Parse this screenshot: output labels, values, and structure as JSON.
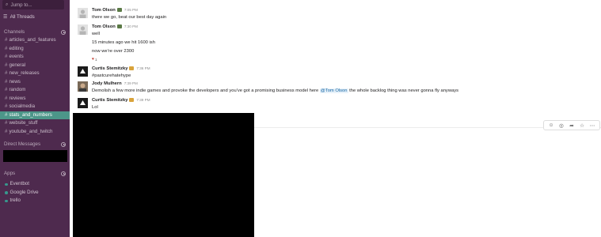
{
  "sidebar": {
    "jump_placeholder": "Jump to...",
    "all_threads": "All Threads",
    "channels_header": "Channels",
    "channels": [
      {
        "label": "articles_and_features",
        "active": false
      },
      {
        "label": "editing",
        "active": false
      },
      {
        "label": "events",
        "active": false
      },
      {
        "label": "general",
        "active": false
      },
      {
        "label": "new_releases",
        "active": false
      },
      {
        "label": "news",
        "active": false
      },
      {
        "label": "random",
        "active": false
      },
      {
        "label": "reviews",
        "active": false
      },
      {
        "label": "socialmedia",
        "active": false
      },
      {
        "label": "stats_and_numbers",
        "active": true
      },
      {
        "label": "website_stuff",
        "active": false
      },
      {
        "label": "youtube_and_twitch",
        "active": false
      }
    ],
    "dm_header": "Direct Messages",
    "apps_header": "Apps",
    "apps": [
      {
        "label": "Eventbot"
      },
      {
        "label": "Google Drive"
      },
      {
        "label": "trello"
      }
    ],
    "colors": {
      "background": "#4e2a4e",
      "active": "#4c9689",
      "app_dot": "#38978d"
    }
  },
  "messages": [
    {
      "author": "Tom Olson",
      "time": "7:05 PM",
      "lines": [
        "there we go, beat our best day again"
      ]
    },
    {
      "author": "Tom Olson",
      "time": "7:30 PM",
      "lines": [
        "well",
        "15 minutes ago we hit 1600 ish",
        "now we're over 2300"
      ],
      "reaction": {
        "emoji": "♥",
        "count": "1"
      }
    },
    {
      "author": "Curtis Stemitzky",
      "time": "7:36 PM",
      "lines": [
        "#pastcurehatehype"
      ]
    },
    {
      "author": "Jody Mulhern",
      "time": "7:39 PM",
      "line_parts": {
        "before": "Demolish a few more indie games and provoke the developers and you've got a promising business model here ",
        "mention": "@Tom Olson",
        "after": "  the whole backlog thing was never gonna fly anyways"
      }
    },
    {
      "author": "Curtis Stemitzky",
      "time": "7:39 PM",
      "lines": [
        "Lol"
      ]
    }
  ],
  "hover_actions": [
    {
      "icon": "add-reaction-icon",
      "glyph": "☺"
    },
    {
      "icon": "start-thread-icon",
      "glyph": "◎"
    },
    {
      "icon": "share-icon",
      "glyph": "➦"
    },
    {
      "icon": "star-icon",
      "glyph": "☆"
    },
    {
      "icon": "more-actions-icon",
      "glyph": "⋯"
    }
  ]
}
